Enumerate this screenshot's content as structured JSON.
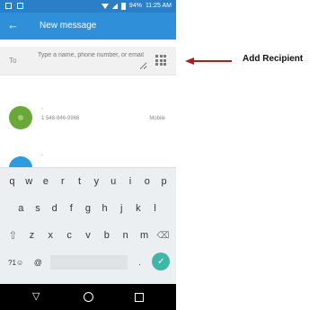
{
  "status_bar": {
    "battery": "94%",
    "time": "11:25 AM"
  },
  "app_bar": {
    "back_icon": "back-arrow-icon",
    "title": "New message"
  },
  "recipient": {
    "label": "To",
    "placeholder": "Type a name, phone number, or email",
    "dialpad_icon": "dialpad-icon"
  },
  "contacts": [
    {
      "name": "-",
      "number": "1 548-846-9966",
      "type": "Mobile",
      "avatar_color": "#6aa83a"
    },
    {
      "name": "-",
      "avatar_color": "#2d9be0"
    }
  ],
  "keyboard": {
    "row1": [
      "q",
      "w",
      "e",
      "r",
      "t",
      "y",
      "u",
      "i",
      "o",
      "p"
    ],
    "row2": [
      "a",
      "s",
      "d",
      "f",
      "g",
      "h",
      "j",
      "k",
      "l"
    ],
    "row3": [
      "z",
      "x",
      "c",
      "v",
      "b",
      "n",
      "m"
    ],
    "shift": "⇧",
    "backspace": "⌫",
    "symbols": "?1☺",
    "at": "@",
    "period": ".",
    "enter": "✓"
  },
  "nav_bar": {
    "back": "▽"
  },
  "annotation": {
    "text": "Add Recipient",
    "color": "#c0141c"
  },
  "colors": {
    "status_bar": "#2a7fc7",
    "app_bar": "#2f8fd8",
    "enter_key": "#3fb6a8"
  }
}
